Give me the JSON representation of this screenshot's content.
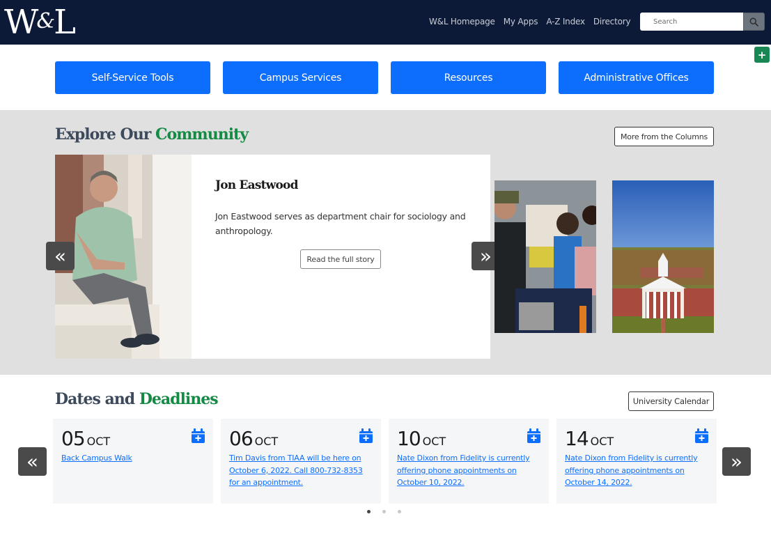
{
  "header": {
    "logo_text_w": "W",
    "logo_text_amp": "&",
    "logo_text_l": "L",
    "links": [
      "W&L Homepage",
      "My Apps",
      "A-Z Index",
      "Directory"
    ],
    "search": {
      "placeholder": "Search",
      "value": ""
    },
    "search_icon": "search-icon"
  },
  "floating_button": {
    "label": "+"
  },
  "quick_nav": [
    "Self-Service Tools",
    "Campus Services",
    "Resources",
    "Administrative Offices"
  ],
  "explore": {
    "title_part1": "Explore Our",
    "title_part2": "Community",
    "more_button": "More from the Columns",
    "feature": {
      "name": "Jon Eastwood",
      "description": "Jon Eastwood serves as department chair for sociology and anthropology.",
      "button": "Read the full story"
    },
    "prev_arrow": "«",
    "next_arrow": "»"
  },
  "dates": {
    "title_part1": "Dates and",
    "title_part2": "Deadlines",
    "calendar_button": "University Calendar",
    "prev_arrow": "«",
    "next_arrow": "»",
    "items": [
      {
        "day": "05",
        "month": "OCT",
        "text": "Back Campus Walk"
      },
      {
        "day": "06",
        "month": "OCT",
        "text": "Tim Davis from TIAA will be here on October 6, 2022. Call 800-732-8353 for an appointment."
      },
      {
        "day": "10",
        "month": "OCT",
        "text": "Nate Dixon from Fidelity is currently offering phone appointments on October 10, 2022."
      },
      {
        "day": "14",
        "month": "OCT",
        "text": "Nate Dixon from Fidelity is currently offering phone appointments on October 14, 2022."
      }
    ],
    "pagination": {
      "pages": 3,
      "active": 1
    }
  },
  "colors": {
    "header_bg": "#0d1a37",
    "primary_blue": "#0d6efd",
    "accent_green": "#158a45",
    "title_slate": "#3d4a5c"
  }
}
